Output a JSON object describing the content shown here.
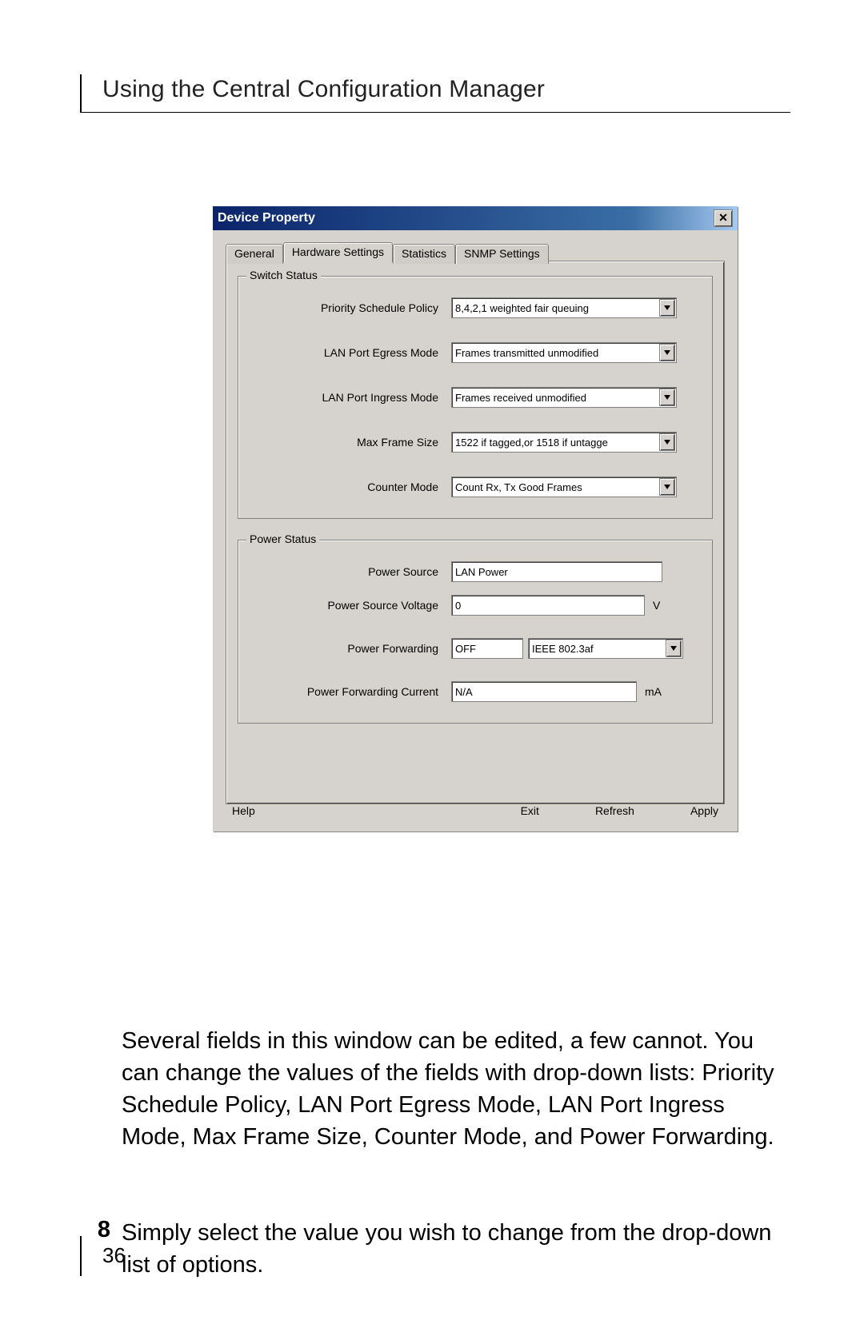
{
  "header": {
    "title": "Using the Central Configuration Manager"
  },
  "dialog": {
    "title": "Device Property",
    "tabs": [
      "General",
      "Hardware Settings",
      "Statistics",
      "SNMP Settings"
    ],
    "active_tab": 1,
    "switch_status": {
      "legend": "Switch Status",
      "priority_label": "Priority Schedule Policy",
      "priority_value": "8,4,2,1 weighted fair queuing",
      "egress_label": "LAN Port Egress Mode",
      "egress_value": "Frames transmitted unmodified",
      "ingress_label": "LAN Port Ingress Mode",
      "ingress_value": "Frames received unmodified",
      "maxframe_label": "Max Frame Size",
      "maxframe_value": "1522 if tagged,or 1518 if untagge",
      "counter_label": "Counter Mode",
      "counter_value": "Count Rx, Tx Good Frames"
    },
    "power_status": {
      "legend": "Power Status",
      "source_label": "Power  Source",
      "source_value": "LAN Power",
      "voltage_label": "Power Source Voltage",
      "voltage_value": "0",
      "voltage_unit": "V",
      "forwarding_label": "Power Forwarding",
      "forwarding_value1": "OFF",
      "forwarding_value2": "IEEE 802.3af",
      "current_label": "Power Forwarding Current",
      "current_value": "N/A",
      "current_unit": "mA"
    },
    "buttons": {
      "help": "Help",
      "exit": "Exit",
      "refresh": "Refresh",
      "apply": "Apply"
    }
  },
  "body": {
    "para": "Several fields in this window can be edited, a few cannot. You can change the values of the fields with drop-down lists: Priority Schedule Policy, LAN Port Egress Mode, LAN Port Ingress Mode, Max Frame Size, Counter Mode, and Power Forwarding.",
    "step_num": "8",
    "step_text": "Simply select the value you wish to change from the drop-down list of options."
  },
  "footer": {
    "page_num": "36"
  }
}
